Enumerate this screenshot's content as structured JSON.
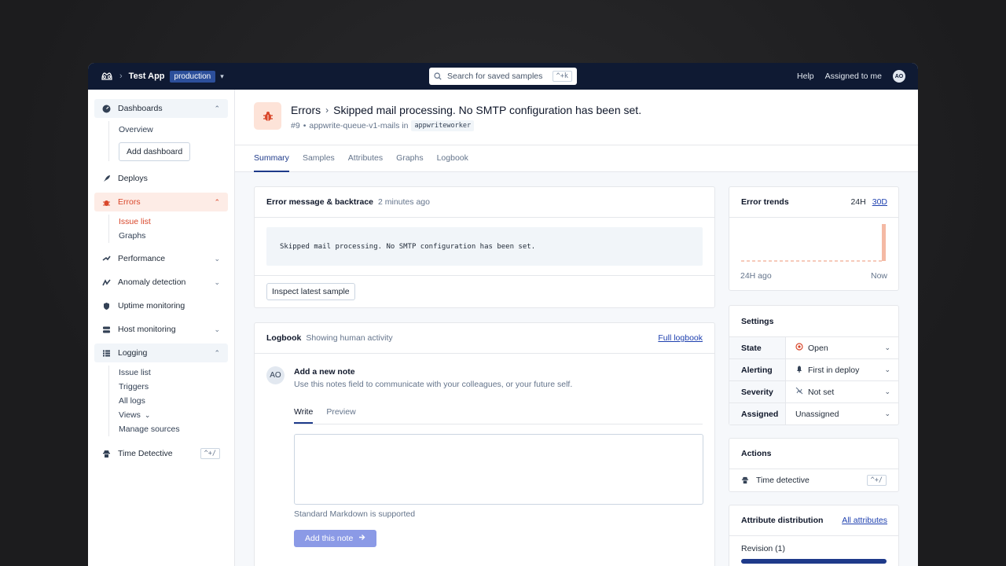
{
  "topbar": {
    "app_name": "Test App",
    "environment": "production",
    "search_placeholder": "Search for saved samples",
    "search_shortcut": "^+k",
    "help": "Help",
    "assigned": "Assigned to me",
    "avatar": "AO"
  },
  "sidebar": {
    "dashboards": "Dashboards",
    "overview": "Overview",
    "add_dashboard": "Add dashboard",
    "deploys": "Deploys",
    "errors": "Errors",
    "issue_list": "Issue list",
    "graphs": "Graphs",
    "performance": "Performance",
    "anomaly": "Anomaly detection",
    "uptime": "Uptime monitoring",
    "host": "Host monitoring",
    "logging": "Logging",
    "log_issue_list": "Issue list",
    "triggers": "Triggers",
    "all_logs": "All logs",
    "views": "Views",
    "manage_sources": "Manage sources",
    "time_detective": "Time Detective",
    "time_detective_shortcut": "^+/"
  },
  "header": {
    "section": "Errors",
    "title": "Skipped mail processing. No SMTP configuration has been set.",
    "number": "#9",
    "queue": "appwrite-queue-v1-mails in",
    "worker": "appwriteworker"
  },
  "tabs": [
    "Summary",
    "Samples",
    "Attributes",
    "Graphs",
    "Logbook"
  ],
  "error_card": {
    "heading": "Error message & backtrace",
    "time": "2 minutes ago",
    "message": "Skipped mail processing. No SMTP configuration has been set.",
    "inspect": "Inspect latest sample"
  },
  "logbook": {
    "heading": "Logbook",
    "sub": "Showing human activity",
    "full": "Full logbook",
    "avatar": "AO",
    "note_title": "Add a new note",
    "note_hint": "Use this notes field to communicate with your colleagues, or your future self.",
    "write": "Write",
    "preview": "Preview",
    "markdown": "Standard Markdown is supported",
    "add_note": "Add this note"
  },
  "trends": {
    "heading": "Error trends",
    "range_24h": "24H",
    "range_30d": "30D",
    "start": "24H ago",
    "end": "Now"
  },
  "settings": {
    "heading": "Settings",
    "rows": [
      {
        "label": "State",
        "value": "Open"
      },
      {
        "label": "Alerting",
        "value": "First in deploy"
      },
      {
        "label": "Severity",
        "value": "Not set"
      },
      {
        "label": "Assigned",
        "value": "Unassigned"
      }
    ]
  },
  "actions": {
    "heading": "Actions",
    "time_detective": "Time detective",
    "shortcut": "^+/"
  },
  "attributes": {
    "heading": "Attribute distribution",
    "all": "All attributes",
    "revision": "Revision (1)",
    "revision_fill": 1.0
  },
  "colors": {
    "accent": "#d9472b",
    "navy": "#0f1a33",
    "primary_button": "#8b9ae6"
  }
}
